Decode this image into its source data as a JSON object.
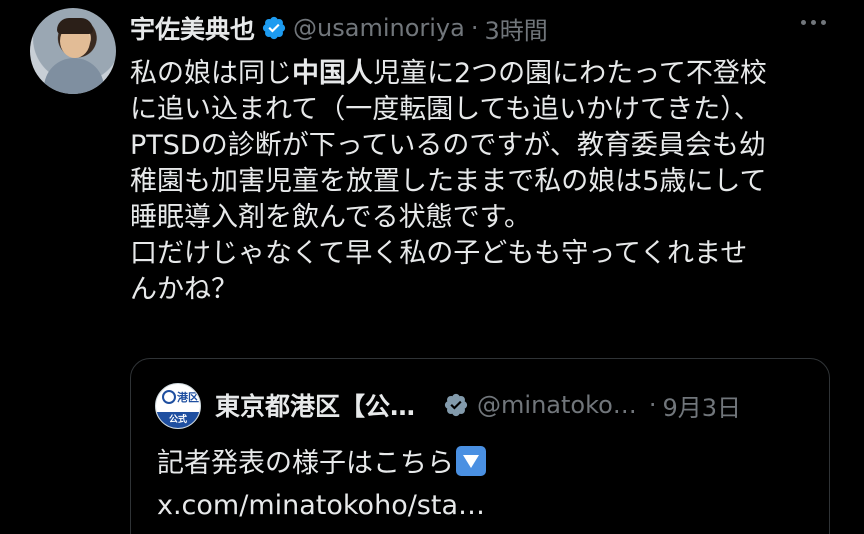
{
  "tweet": {
    "author_name": "宇佐美典也",
    "author_handle": "@usaminoriya",
    "separator": "·",
    "timestamp": "3時間",
    "verified_color": "#1d9bf0",
    "text_lines": [
      [
        "私の娘は同じ",
        "中国人",
        "児童に2つの園にわたって不登校"
      ],
      "に追い込まれて（一度転園しても追いかけてきた）、",
      "PTSDの診断が下っているのですが、教育委員会も幼",
      "稚園も加害児童を放置したままで私の娘は5歳にして",
      "睡眠導入剤を飲んでる状態です。",
      "口だけじゃなくて早く私の子どもも守ってくれませ",
      "んかね？"
    ]
  },
  "quote": {
    "author_name": "東京都港区【公…",
    "author_handle": "@minatoko…",
    "separator": "·",
    "date": "9月3日",
    "avatar_band_text": "公式",
    "avatar_kanji": "港区",
    "text_line1": "記者発表の様子はこちら",
    "link": "x.com/minatokoho/sta…",
    "verified_color": "#829aab"
  },
  "icons": {
    "more": "more-horizontal-icon",
    "verified": "verified-badge-icon",
    "emoji": "down-arrow-emoji-icon"
  }
}
